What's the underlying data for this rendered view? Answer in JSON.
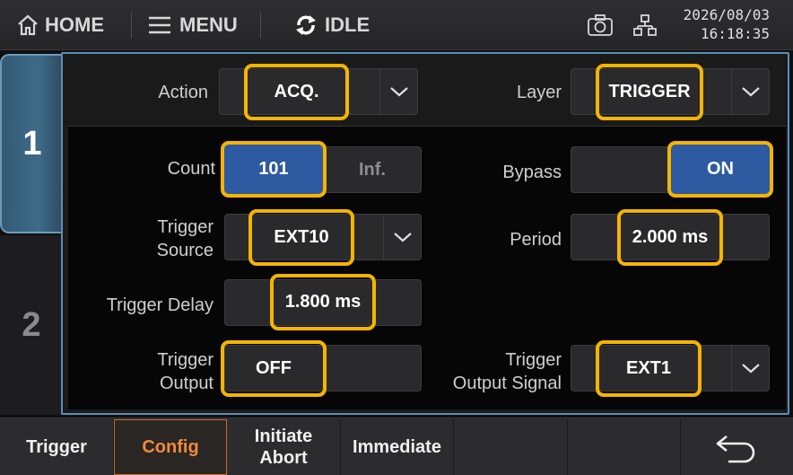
{
  "header": {
    "home_label": "HOME",
    "menu_label": "MENU",
    "state_label": "IDLE",
    "date": "2026/08/03",
    "time": "16:18:35"
  },
  "tabs": [
    {
      "label": "1",
      "selected": true
    },
    {
      "label": "2",
      "selected": false
    }
  ],
  "config": {
    "action": {
      "label": "Action",
      "value": "ACQ."
    },
    "layer": {
      "label": "Layer",
      "value": "TRIGGER"
    },
    "count": {
      "label": "Count",
      "value": "101",
      "alt": "Inf."
    },
    "bypass": {
      "label": "Bypass",
      "value": "ON"
    },
    "trigger_source": {
      "label_line1": "Trigger",
      "label_line2": "Source",
      "value": "EXT10"
    },
    "period": {
      "label": "Period",
      "value": "2.000 ms"
    },
    "trigger_delay": {
      "label": "Trigger Delay",
      "value": "1.800 ms"
    },
    "trigger_output": {
      "label_line1": "Trigger",
      "label_line2": "Output",
      "value": "OFF"
    },
    "trigger_output_signal": {
      "label_line1": "Trigger",
      "label_line2": "Output Signal",
      "value": "EXT1"
    }
  },
  "softkeys": [
    {
      "label": "Trigger"
    },
    {
      "label": "Config",
      "active": true
    },
    {
      "line1": "Initiate",
      "line2": "Abort"
    },
    {
      "label": "Immediate"
    },
    {
      "label": ""
    },
    {
      "label": ""
    },
    {
      "icon": "back-arrow-icon"
    }
  ],
  "colors": {
    "highlight": "#f5b400",
    "selected_blue": "#2d5aa0",
    "active_softkey": "#f08a3c",
    "panel_border": "#5a8fb6"
  }
}
